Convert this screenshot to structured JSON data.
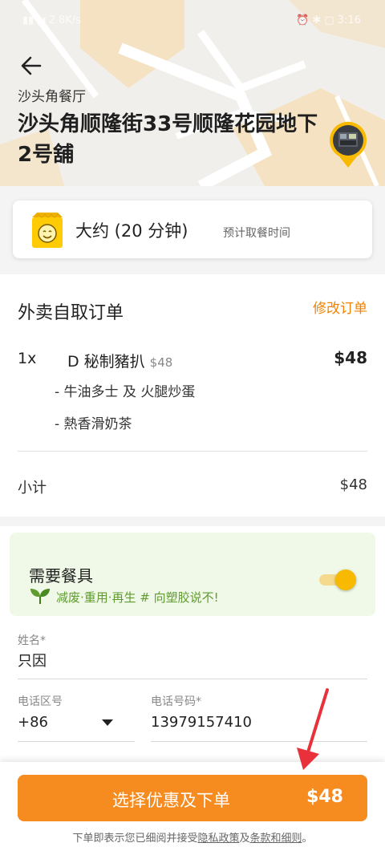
{
  "status_bar": {
    "left": "▮▮ ◢ 2.8K/s",
    "right": "⏰ ✱ ▢ 3:16"
  },
  "header": {
    "restaurant_label": "沙头角餐厅",
    "address": "沙头角顺隆街33号顺隆花园地下2号舖",
    "pin_icon": "store-location-pin-icon"
  },
  "pickup_time": {
    "main": "大约 (20 分钟)",
    "note": "预计取餐时间",
    "icon": "smiling-bag-icon"
  },
  "order": {
    "title": "外卖自取订单",
    "edit_label": "修改订单",
    "items": [
      {
        "qty": "1x",
        "name": "D 秘制豬扒",
        "unit_price": "$48",
        "price": "$48",
        "options": [
          "- 牛油多士 及 火腿炒蛋",
          "- 熱香滑奶茶"
        ]
      }
    ],
    "subtotal_label": "小计",
    "subtotal_value": "$48"
  },
  "cutlery": {
    "title": "需要餐具",
    "slogan": "减废·重用·再生 # 向塑胶说不!",
    "enabled": true
  },
  "form": {
    "name_label": "姓名*",
    "name_value": "只因",
    "code_label": "电话区号",
    "code_value": "+86",
    "phone_label": "电话号码*",
    "phone_value": "13979157410"
  },
  "checkout": {
    "button_label": "选择优惠及下单",
    "total": "$48"
  },
  "footer": {
    "prefix": "下单即表示您已细阅并接受",
    "privacy_link": "隐私政策",
    "and": "及",
    "terms_link": "条款和细则",
    "suffix": "。"
  },
  "colors": {
    "accent": "#f68b1f",
    "edit_link": "#f08300",
    "eco_green": "#5f9b2e",
    "eco_card_bg": "#f0f9e7",
    "toggle_on": "#f8ba00"
  }
}
